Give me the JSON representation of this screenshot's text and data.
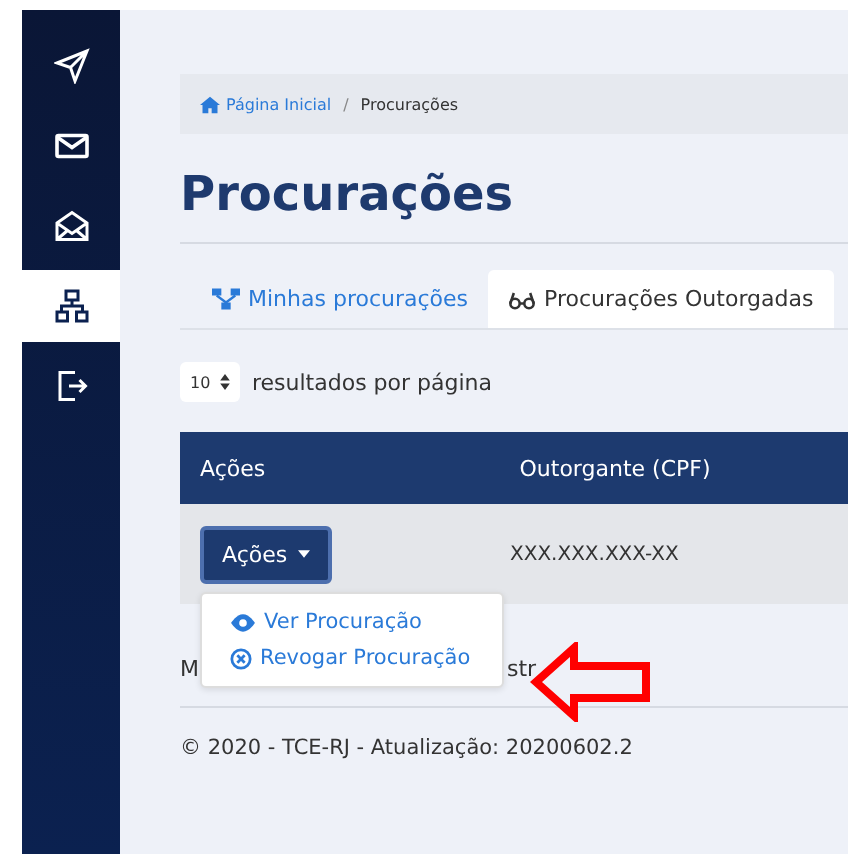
{
  "sidebar": {
    "items": [
      {
        "selected": false
      },
      {
        "selected": false
      },
      {
        "selected": false
      },
      {
        "selected": true
      },
      {
        "selected": false
      }
    ]
  },
  "breadcrumb": {
    "separator": "/",
    "items": [
      {
        "label": "Página Inicial",
        "kind": "link"
      },
      {
        "label": "Procurações",
        "kind": "current"
      }
    ]
  },
  "title": "Procurações",
  "tabs": [
    {
      "label": "Minhas procurações",
      "selected": false
    },
    {
      "label": "Procurações Outorgadas",
      "selected": true
    }
  ],
  "page_size": {
    "value": "10",
    "label": "resultados por página"
  },
  "table": {
    "columns": [
      "Ações",
      "Outorgante (CPF)"
    ],
    "rows": [
      {
        "action_button": "Ações",
        "cpf": "XXX.XXX.XXX-XX"
      }
    ]
  },
  "dropdown": {
    "items": [
      {
        "label": "Ver Procuração"
      },
      {
        "label": "Revogar Procuração"
      }
    ]
  },
  "covered_text": [
    "M",
    "str"
  ],
  "footer": "© 2020 - TCE-RJ - Atualização: 20200602.2"
}
